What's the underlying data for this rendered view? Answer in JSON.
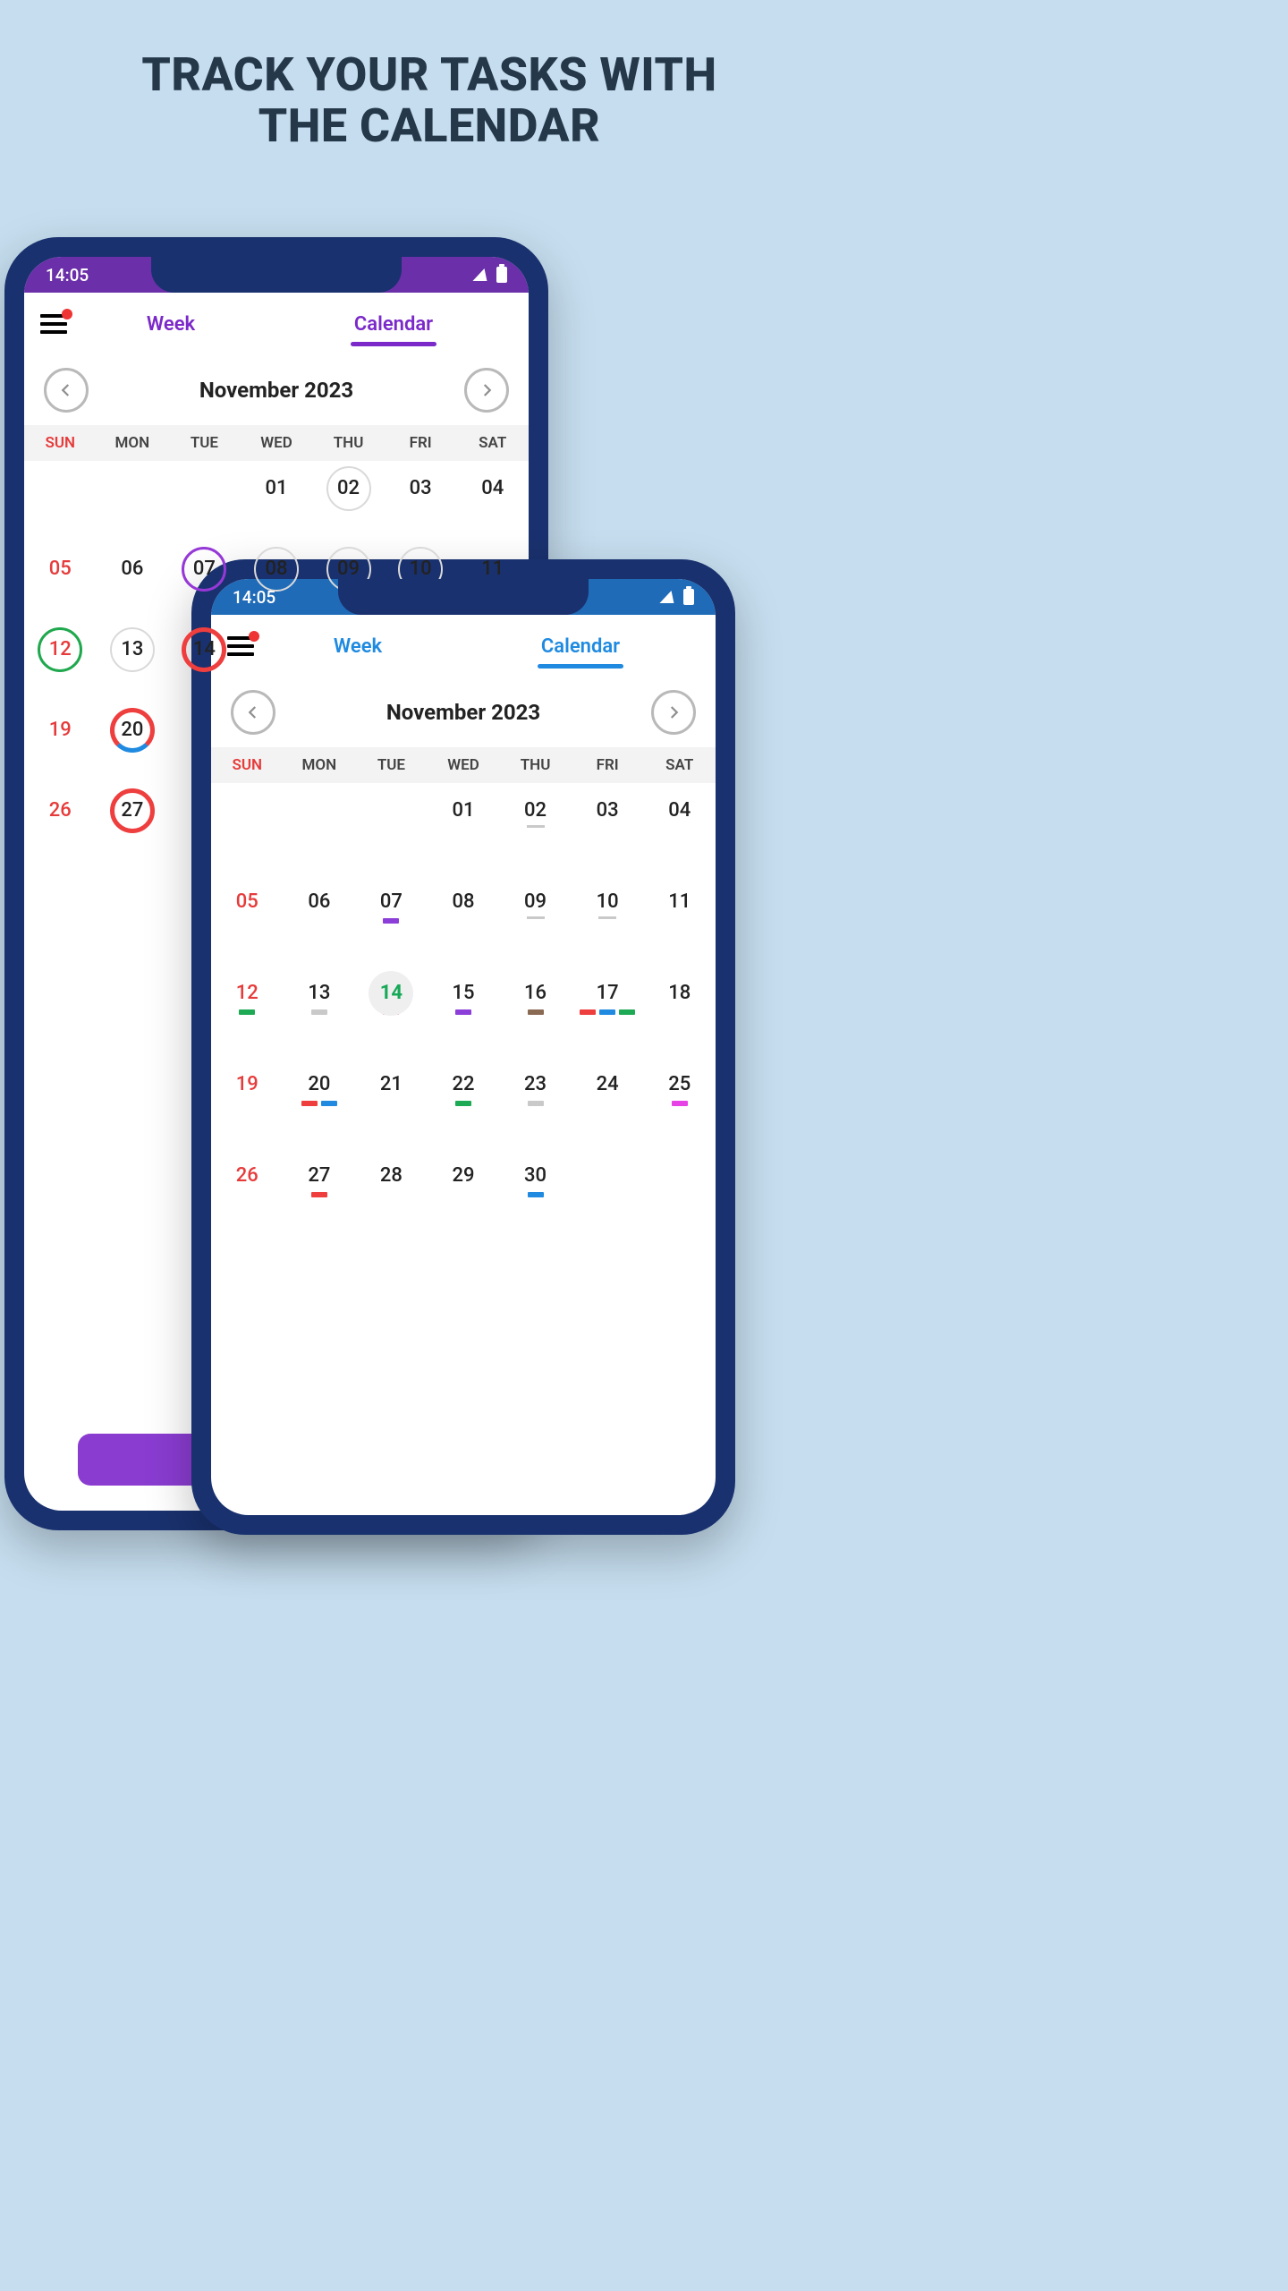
{
  "headline_l1": "TRACK YOUR TASKS WITH",
  "headline_l2": "THE CALENDAR",
  "status_time": "14:05",
  "tabs": {
    "week": "Week",
    "calendar": "Calendar"
  },
  "month_label": "November 2023",
  "dow": [
    "SUN",
    "MON",
    "TUE",
    "WED",
    "THU",
    "FRI",
    "SAT"
  ],
  "phoneA": {
    "accent": "#7b29c9",
    "grid": [
      [
        "",
        "",
        "",
        "01",
        "02",
        "03",
        "04"
      ],
      [
        "05",
        "06",
        "07",
        "08",
        "09",
        "10",
        "11"
      ],
      [
        "12",
        "13",
        "14",
        "",
        "",
        "",
        ""
      ],
      [
        "19",
        "20",
        "",
        "",
        "",
        "",
        ""
      ],
      [
        "26",
        "27",
        "",
        "",
        "",
        "",
        ""
      ]
    ],
    "decor": {
      "02": "ring-grey",
      "07": "ring-purple",
      "08": "ring-grey",
      "09": "ring-grey",
      "10": "ring-grey",
      "12": "ring-green",
      "13": "ring-grey",
      "14": "ring-red",
      "20": "ring-halfrb",
      "27": "ring-red"
    }
  },
  "phoneB": {
    "accent": "#1f8ae0",
    "grid": [
      [
        "",
        "",
        "",
        "01",
        "02",
        "03",
        "04"
      ],
      [
        "05",
        "06",
        "07",
        "08",
        "09",
        "10",
        "11"
      ],
      [
        "12",
        "13",
        "14",
        "15",
        "16",
        "17",
        "18"
      ],
      [
        "19",
        "20",
        "21",
        "22",
        "23",
        "24",
        "25"
      ],
      [
        "26",
        "27",
        "28",
        "29",
        "30",
        "",
        ""
      ]
    ],
    "today": "14",
    "underline": [
      "02",
      "09",
      "10"
    ],
    "marks": {
      "07": [
        "purple"
      ],
      "12": [
        "green"
      ],
      "13": [
        "grey"
      ],
      "14": [
        "red"
      ],
      "15": [
        "purple"
      ],
      "16": [
        "brown"
      ],
      "17": [
        "red",
        "blue",
        "green"
      ],
      "20": [
        "red",
        "blue"
      ],
      "22": [
        "green"
      ],
      "23": [
        "grey"
      ],
      "25": [
        "pink"
      ],
      "27": [
        "red"
      ],
      "30": [
        "blue"
      ]
    }
  }
}
